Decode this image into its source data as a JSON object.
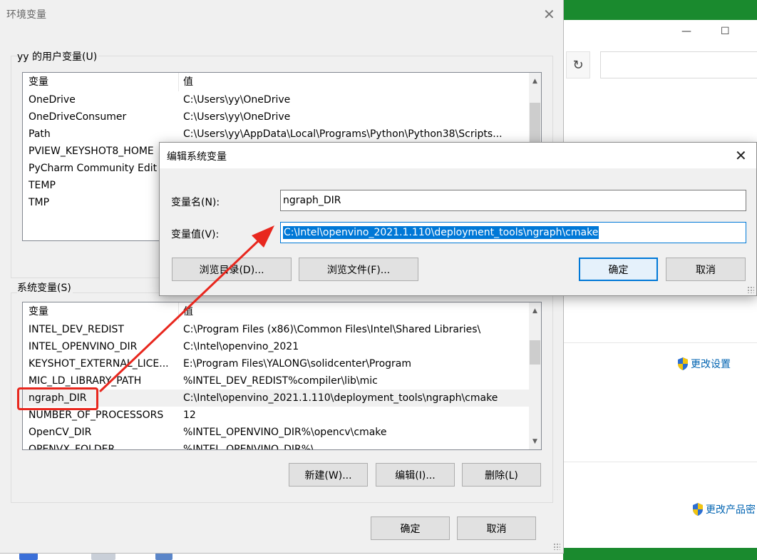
{
  "background_window": {
    "minimize_glyph": "—",
    "maximize_glyph": "☐",
    "refresh_glyph": "↻",
    "link_change_settings": "更改设置",
    "link_change_product_key": "更改产品密"
  },
  "env_window": {
    "title": "环境变量",
    "close_glyph": "✕",
    "user_group_title": "yy 的用户变量(U)",
    "user_columns": {
      "name": "变量",
      "value": "值"
    },
    "user_rows": [
      {
        "name": "OneDrive",
        "value": "C:\\Users\\yy\\OneDrive"
      },
      {
        "name": "OneDriveConsumer",
        "value": "C:\\Users\\yy\\OneDrive"
      },
      {
        "name": "Path",
        "value": "C:\\Users\\yy\\AppData\\Local\\Programs\\Python\\Python38\\Scripts..."
      },
      {
        "name": "PVIEW_KEYSHOT8_HOME",
        "value": ""
      },
      {
        "name": "PyCharm Community Edit",
        "value": ""
      },
      {
        "name": "TEMP",
        "value": ""
      },
      {
        "name": "TMP",
        "value": ""
      }
    ],
    "system_group_title": "系统变量(S)",
    "system_columns": {
      "name": "变量",
      "value": "值"
    },
    "system_rows": [
      {
        "name": "INTEL_DEV_REDIST",
        "value": "C:\\Program Files (x86)\\Common Files\\Intel\\Shared Libraries\\"
      },
      {
        "name": "INTEL_OPENVINO_DIR",
        "value": "C:\\Intel\\openvino_2021"
      },
      {
        "name": "KEYSHOT_EXTERNAL_LICE...",
        "value": "E:\\Program Files\\YALONG\\solidcenter\\Program"
      },
      {
        "name": "MIC_LD_LIBRARY_PATH",
        "value": "%INTEL_DEV_REDIST%compiler\\lib\\mic"
      },
      {
        "name": "ngraph_DIR",
        "value": "C:\\Intel\\openvino_2021.1.110\\deployment_tools\\ngraph\\cmake"
      },
      {
        "name": "NUMBER_OF_PROCESSORS",
        "value": "12"
      },
      {
        "name": "OpenCV_DIR",
        "value": "%INTEL_OPENVINO_DIR%\\opencv\\cmake"
      },
      {
        "name": "OPENVX_FOLDER",
        "value": "%INTEL_OPENVINO_DIR%\\"
      }
    ],
    "buttons": {
      "new": "新建(W)...",
      "edit": "编辑(I)...",
      "delete": "删除(L)",
      "ok": "确定",
      "cancel": "取消"
    },
    "scroll_up": "▲",
    "scroll_down": "▼"
  },
  "edit_dialog": {
    "title": "编辑系统变量",
    "close_glyph": "✕",
    "name_label": "变量名(N):",
    "name_value": "ngraph_DIR",
    "value_label": "变量值(V):",
    "value_value": "C:\\Intel\\openvino_2021.1.110\\deployment_tools\\ngraph\\cmake",
    "buttons": {
      "browse_dir": "浏览目录(D)...",
      "browse_file": "浏览文件(F)...",
      "ok": "确定",
      "cancel": "取消"
    }
  },
  "annotation": {
    "color": "#e8271e"
  }
}
